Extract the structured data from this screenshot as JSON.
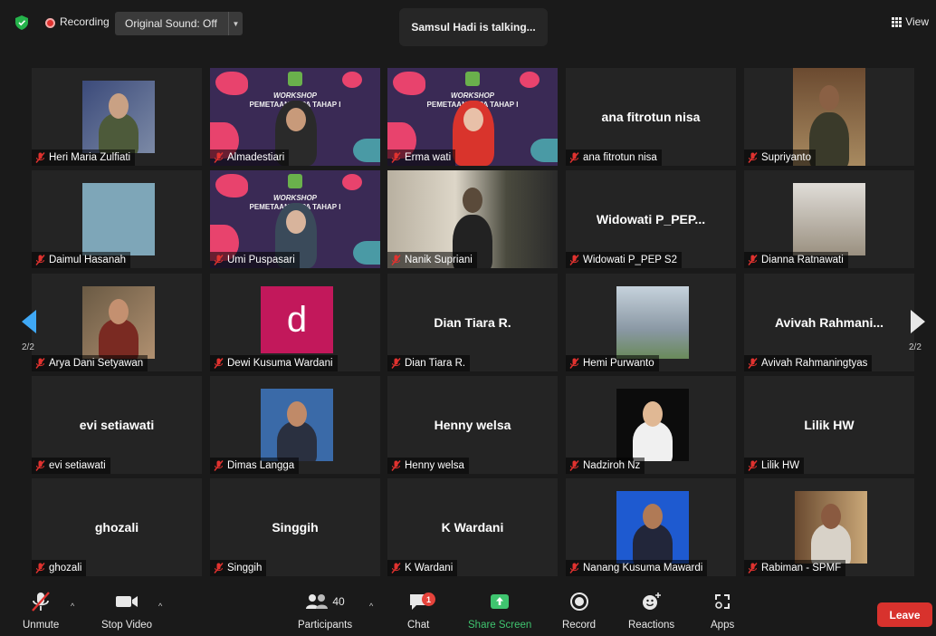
{
  "topbar": {
    "recording_label": "Recording",
    "original_sound_label": "Original Sound: Off",
    "talking_banner": "Samsul Hadi is talking...",
    "view_label": "View"
  },
  "slide_text": {
    "line1": "WORKSHOP",
    "line2": "PEMETAAN PEPA TAHAP I"
  },
  "tiles": [
    {
      "label": "Heri  Maria Zulfiati",
      "center": ""
    },
    {
      "label": "Almadestiari",
      "center": ""
    },
    {
      "label": "Erma wati",
      "center": ""
    },
    {
      "label": "ana fitrotun nisa",
      "center": "ana fitrotun nisa"
    },
    {
      "label": "Supriyanto",
      "center": ""
    },
    {
      "label": "Daimul Hasanah",
      "center": ""
    },
    {
      "label": "Umi Puspasari",
      "center": ""
    },
    {
      "label": "Nanik Supriani",
      "center": ""
    },
    {
      "label": "Widowati P_PEP S2",
      "center": "Widowati  P_PEP..."
    },
    {
      "label": "Dianna Ratnawati",
      "center": ""
    },
    {
      "label": "Arya Dani Setyawan",
      "center": ""
    },
    {
      "label": "Dewi Kusuma Wardani",
      "center": "",
      "avatar_letter": "d"
    },
    {
      "label": "Dian Tiara R.",
      "center": "Dian Tiara R."
    },
    {
      "label": "Hemi Purwanto",
      "center": ""
    },
    {
      "label": "Avivah Rahmaningtyas",
      "center": "Avivah  Rahmani..."
    },
    {
      "label": "evi setiawati",
      "center": "evi setiawati"
    },
    {
      "label": "Dimas Langga",
      "center": ""
    },
    {
      "label": "Henny welsa",
      "center": "Henny welsa"
    },
    {
      "label": "Nadziroh Nz",
      "center": ""
    },
    {
      "label": "Lilik HW",
      "center": "Lilik HW"
    },
    {
      "label": "ghozali",
      "center": "ghozali"
    },
    {
      "label": "Singgih",
      "center": "Singgih"
    },
    {
      "label": "K Wardani",
      "center": "K Wardani"
    },
    {
      "label": "Nanang Kusuma Mawardi",
      "center": ""
    },
    {
      "label": "Rabiman - SPMF",
      "center": ""
    }
  ],
  "pagination": {
    "left": "2/2",
    "right": "2/2"
  },
  "toolbar": {
    "unmute": "Unmute",
    "stop_video": "Stop Video",
    "participants": "Participants",
    "participant_count": "40",
    "chat": "Chat",
    "chat_badge": "1",
    "share_screen": "Share Screen",
    "record": "Record",
    "reactions": "Reactions",
    "apps": "Apps",
    "leave": "Leave"
  },
  "colors": {
    "background": "#1a1a1a",
    "tile": "#242424",
    "accent_green": "#3fc46f",
    "leave_red": "#d8322d",
    "nav_blue": "#3fa8f5",
    "avatar_magenta": "#c2185b"
  }
}
